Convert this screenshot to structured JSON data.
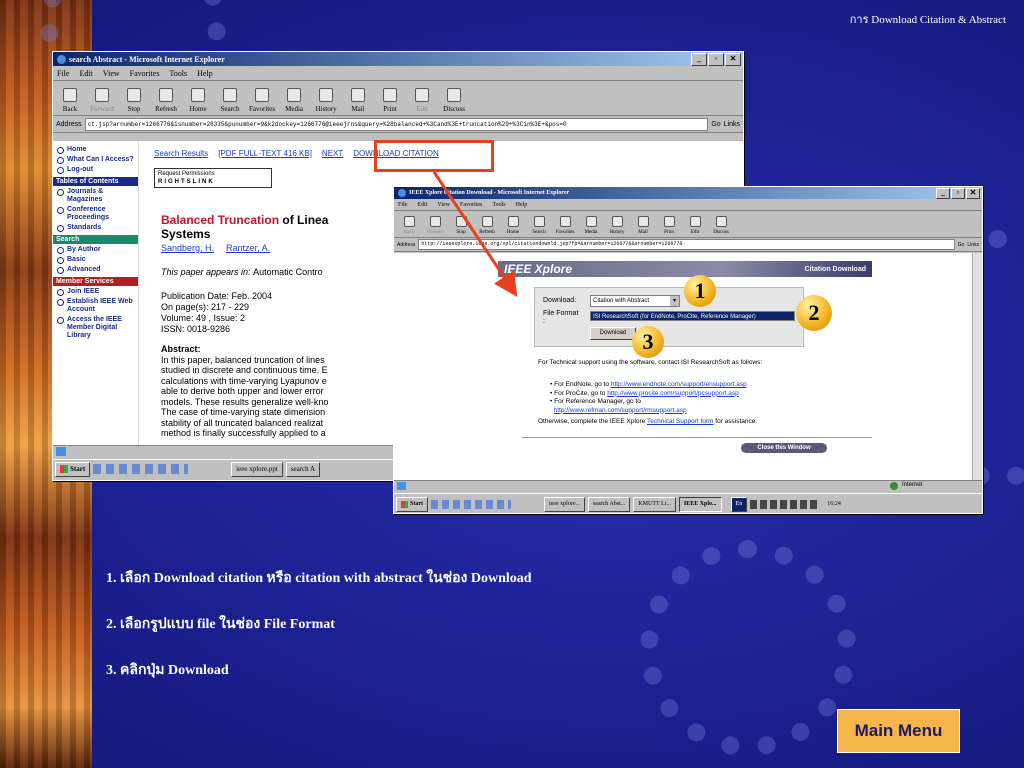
{
  "slide": {
    "header": "การ Download Citation & Abstract",
    "steps": [
      "1.  เลือก Download citation หรือ citation with abstract ในช่อง Download",
      "2.  เลือกรูปแบบ file ในช่อง File Format",
      "3.  คลิกปุ่ม  Download"
    ],
    "callouts": [
      "1",
      "2",
      "3"
    ],
    "main_menu_label": "Main Menu",
    "colors": {
      "background": "#1b1f8e",
      "button": "#f5b54a",
      "highlight": "#e8401c"
    }
  },
  "win1": {
    "title": "search Abstract - Microsoft Internet Explorer",
    "menu": [
      "File",
      "Edit",
      "View",
      "Favorites",
      "Tools",
      "Help"
    ],
    "toolbar": [
      "Back",
      "Forward",
      "Stop",
      "Refresh",
      "Home",
      "Search",
      "Favorites",
      "Media",
      "History",
      "Mail",
      "Print",
      "Edit",
      "Discuss"
    ],
    "address_label": "Address",
    "address": "ct.jsp?arnumber=1266776&isnumber=28335&punumber=9&k2dockey=1266776@ieeejrns&query=%28balanced+%3Cand%3E+truncation%29+%3Cin%3E+&pos=0",
    "go": "Go",
    "links": "Links",
    "nav": {
      "top": [
        "Home",
        "What Can I Access?",
        "Log-out"
      ],
      "toc_header": "Tables of Contents",
      "toc": [
        "Journals & Magazines",
        "Conference Proceedings",
        "Standards"
      ],
      "search_header": "Search",
      "search": [
        "By Author",
        "Basic",
        "Advanced"
      ],
      "member_header": "Member Services",
      "member": [
        "Join IEEE",
        "Establish IEEE Web Account",
        "Access the IEEE Member Digital Library"
      ]
    },
    "links_row": {
      "results": "Search Results",
      "pdf": "[PDF FULL-TEXT 416 KB]",
      "next": "NEXT",
      "download": "DOWNLOAD CITATION"
    },
    "rights": {
      "line1": "Request Permissions",
      "line2": "RIGHTSLINK"
    },
    "paper": {
      "title_red": "Balanced Truncation",
      "title_rest": " of Linea",
      "title_line2": "Systems",
      "authors": [
        "Sandberg, H.",
        "Rantzer, A."
      ],
      "appears_label": "This paper appears in: ",
      "appears_value": "Automatic Contro",
      "pub_date": "Publication Date: Feb. 2004",
      "pages": "On page(s): 217 - 229",
      "volume": "Volume: 49 , Issue: 2",
      "issn": "ISSN: 0018-9286",
      "abstract_label": "Abstract:",
      "abstract_lines": [
        "In this paper, balanced truncation of lines",
        "studied in discrete and continuous time. E",
        "calculations with time-varying Lyapunov e",
        "able to derive both upper and lower error",
        "models. These results generalize well-kno",
        "The case of time-varying state dimension",
        "stability of all truncated balanced realizat",
        "method is finally successfully applied to a"
      ]
    },
    "taskbar": [
      "Start",
      "ieee xplore.ppt",
      "search A"
    ]
  },
  "win2": {
    "title": "IEEE Xplore Citation Download - Microsoft Internet Explorer",
    "menu": [
      "File",
      "Edit",
      "View",
      "Favorites",
      "Tools",
      "Help"
    ],
    "toolbar": [
      "Back",
      "Forward",
      "Stop",
      "Refresh",
      "Home",
      "Search",
      "Favorites",
      "Media",
      "History",
      "Mail",
      "Print",
      "Edit",
      "Discuss"
    ],
    "address_label": "Address",
    "address": "http://ieeexplore.ieee.org/xpl/citationdownld.jsp?fp=&arnumber=1266776&arnumber=1266776",
    "go": "Go",
    "links": "Links",
    "brand": "IEEE Xplore",
    "header_right": "Citation Download",
    "download_label": "Download:",
    "download_value": "Citation with Abstract",
    "file_format_label": "File Format :",
    "file_format_value": "ISI ResearchSoft (for EndNote, ProCite, Reference Manager)",
    "download_button": "Download",
    "support_intro": "For Technical support using the software, contact ISI ResearchSoft as follows:",
    "support_items": [
      {
        "prefix": "For EndNote, go to ",
        "url": "http://www.endnote.com/support/ensupport.asp"
      },
      {
        "prefix": "For ProCite, go to ",
        "url": "http://www.procite.com/support/pcsupport.asp"
      },
      {
        "prefix": "For Reference Manager, go to ",
        "url": "http://www.refman.com/support/rmsupport.asp"
      }
    ],
    "otherwise_prefix": "Otherwise, complete the IEEE Xplore ",
    "otherwise_link": "Technical Support form",
    "otherwise_suffix": " for assistance.",
    "close_button": "Close this Window",
    "status_zone": "Internet",
    "taskbar": [
      "Start",
      "ieee xplore...",
      "search Abst...",
      "KMUTT Li...",
      "IEEE Xplo..."
    ],
    "lang": "En",
    "clock": "16:24"
  }
}
